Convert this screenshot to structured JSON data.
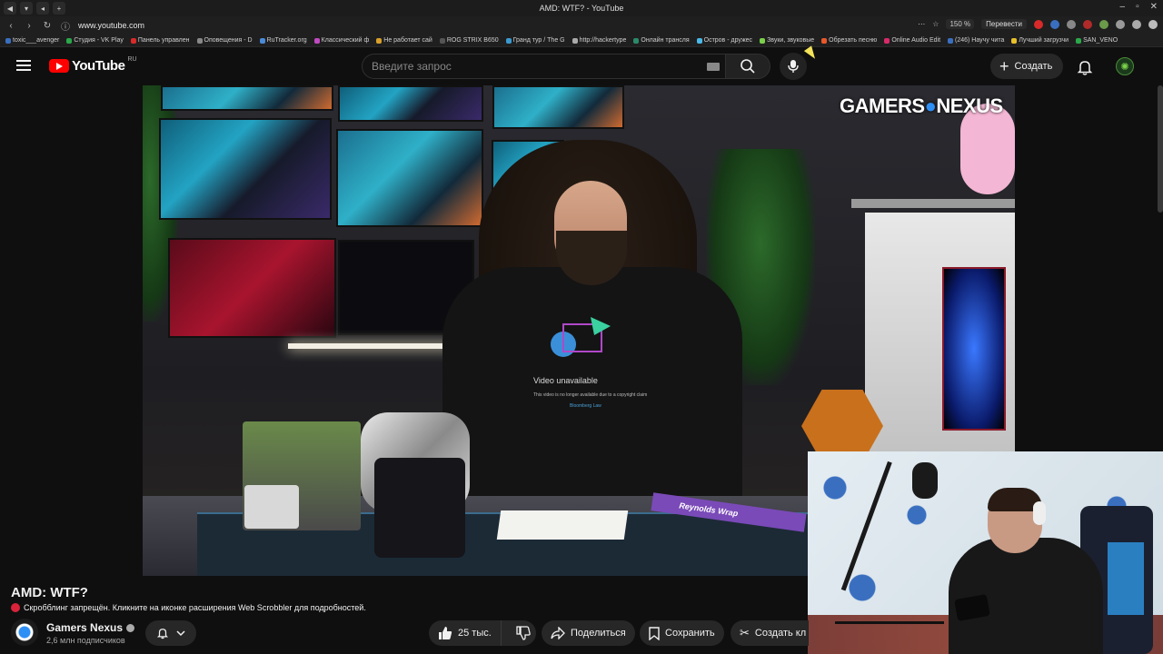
{
  "browser": {
    "window_title": "AMD: WTF? - YouTube",
    "url": "www.youtube.com",
    "zoom": "150 %",
    "translate": "Перевести",
    "bookmarks": [
      "toxic___avenger",
      "Студия - VK Play",
      "Панель управлен",
      "Оповещения - D",
      "RuTracker.org",
      "Классический ф",
      "Не работает сай",
      "ROG STRIX B650",
      "Гранд тур / The G",
      "http://hackertype",
      "Онлайн трансля",
      "Остров - дружес",
      "Звуки, звуковые",
      "Обрезать песню",
      "Online Audio Edit",
      "(246) Научу чита",
      "Лучший загрузчи",
      "SAN_VENO"
    ]
  },
  "header": {
    "logo_text": "YouTube",
    "logo_region": "RU",
    "search_placeholder": "Введите запрос",
    "create_label": "Создать"
  },
  "video": {
    "watermark_left": "GAMERS",
    "watermark_right": "NEXUS",
    "shirt_text": "Video unavailable",
    "shirt_sub": "This video is no longer available due to a copyright claim",
    "shirt_link": "Bloomberg Law",
    "desk_box_text": "Reynolds Wrap"
  },
  "meta": {
    "title": "AMD: WTF?",
    "scrobbler_notice": "Скробблинг запрещён. Кликните на иконке расширения Web Scrobbler для подробностей.",
    "channel_name": "Gamers Nexus",
    "subscribers": "2,6 млн подписчиков",
    "likes": "25 тыс.",
    "share_label": "Поделиться",
    "save_label": "Сохранить",
    "clip_label": "Создать кл"
  },
  "colors": {
    "brand_red": "#ff0000",
    "background": "#0f0f0f",
    "pill_bg": "#272727"
  }
}
